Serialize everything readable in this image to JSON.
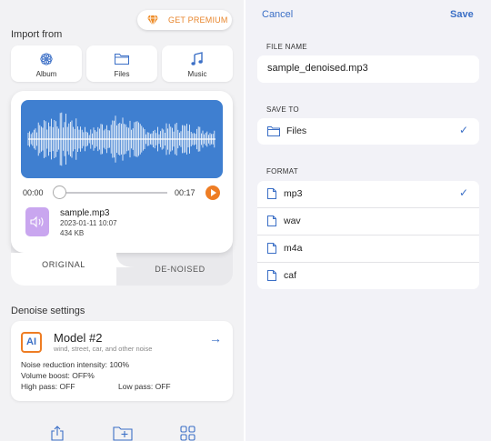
{
  "left": {
    "premium_label": "GET PREMIUM",
    "import_title": "Import from",
    "import_buttons": [
      {
        "label": "Album",
        "icon": "flower-icon"
      },
      {
        "label": "Files",
        "icon": "folder-icon"
      },
      {
        "label": "Music",
        "icon": "music-note-icon"
      }
    ],
    "player": {
      "time_current": "00:00",
      "time_total": "00:17",
      "progress": 0.0,
      "file_name": "sample.mp3",
      "file_date": "2023-01-11 10:07",
      "file_size": "434 KB"
    },
    "tabs": {
      "original": "ORIGINAL",
      "denoised": "DE-NOISED"
    },
    "settings_title": "Denoise settings",
    "model": {
      "badge": "AI",
      "name": "Model #2",
      "description": "wind, street, car, and other noise",
      "noise_reduction": "Noise reduction intensity: 100%",
      "volume_boost": "Volume boost: OFF%",
      "high_pass": "High pass: OFF",
      "low_pass": "Low pass: OFF"
    },
    "bottom_icons": [
      "share-icon",
      "folder-add-icon",
      "grid-icon"
    ]
  },
  "right": {
    "cancel": "Cancel",
    "save": "Save",
    "file_name_label": "FILE NAME",
    "file_name_value": "sample_denoised.mp3",
    "save_to_label": "SAVE TO",
    "save_to_value": "Files",
    "format_label": "FORMAT",
    "formats": [
      {
        "label": "mp3",
        "selected": true
      },
      {
        "label": "wav",
        "selected": false
      },
      {
        "label": "m4a",
        "selected": false
      },
      {
        "label": "caf",
        "selected": false
      }
    ]
  },
  "colors": {
    "accent_blue": "#3b6fc6",
    "accent_orange": "#ee7d24",
    "waveform_bg": "#3f7fd0",
    "file_icon_bg": "#c9a6ef"
  }
}
